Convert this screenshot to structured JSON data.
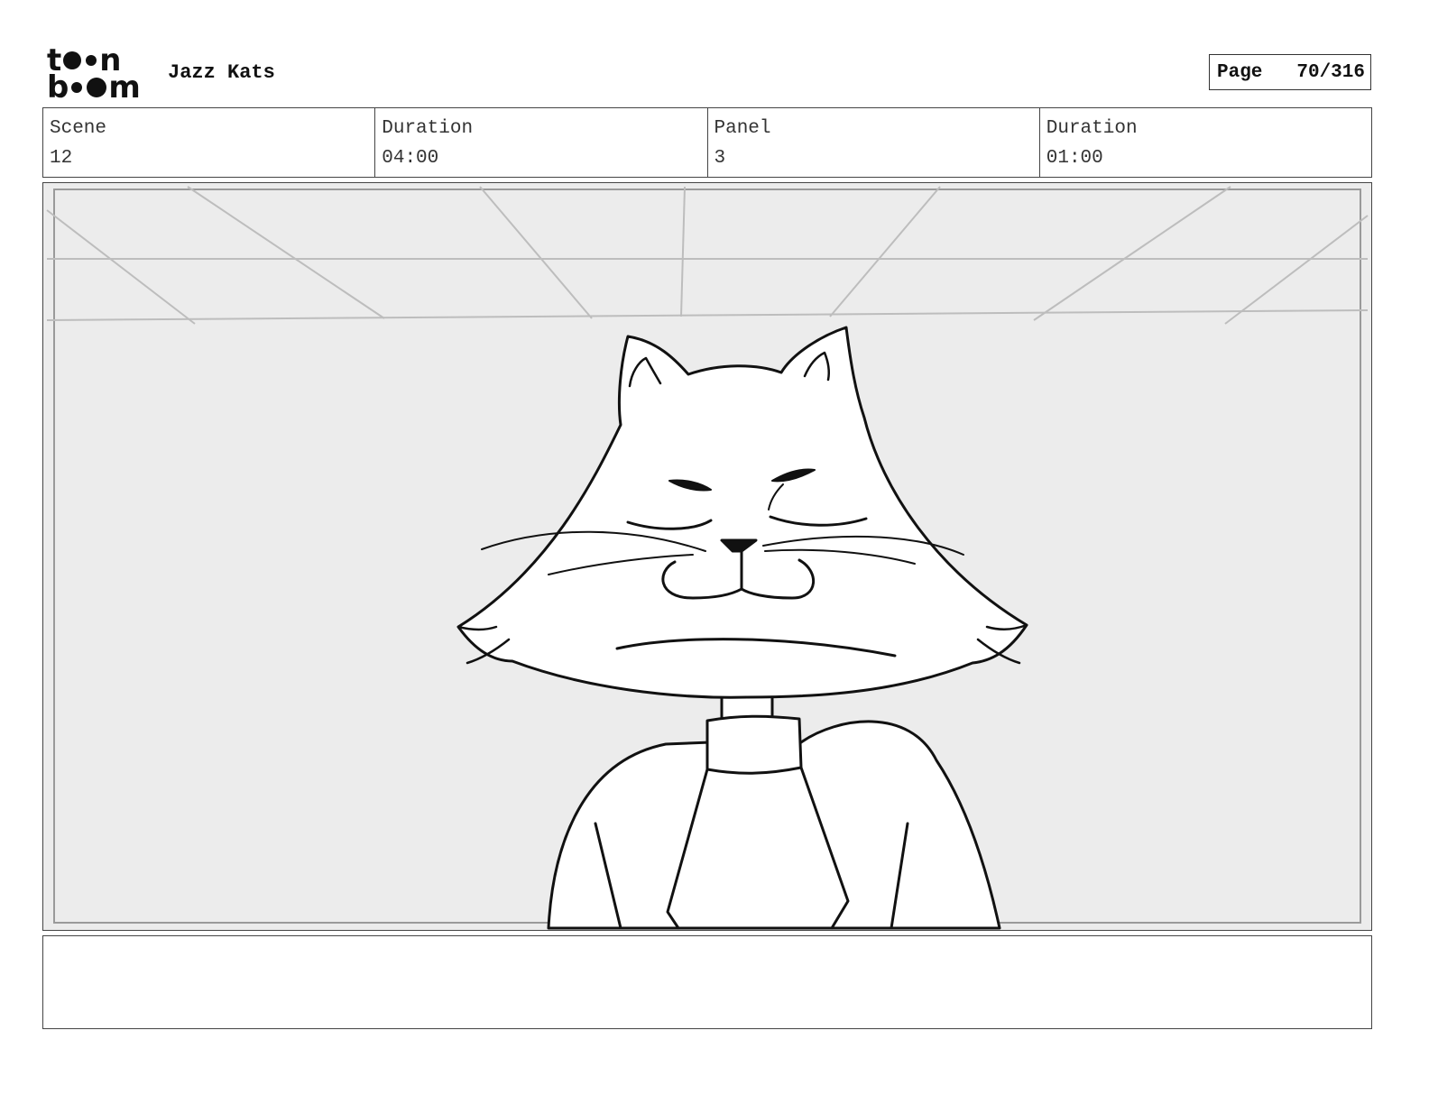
{
  "header": {
    "logo_text": "toon boom",
    "project_title": "Jazz Kats",
    "page_label": "Page",
    "page_number": "70/316"
  },
  "info": {
    "scene_label": "Scene",
    "scene_value": "12",
    "scene_duration_label": "Duration",
    "scene_duration_value": "04:00",
    "panel_label": "Panel",
    "panel_value": "3",
    "panel_duration_label": "Duration",
    "panel_duration_value": "01:00"
  },
  "notes": {
    "text": ""
  },
  "colors": {
    "background_wall": "#ececec",
    "line_art": "#111111",
    "perspective_lines": "#bdbdbd"
  }
}
